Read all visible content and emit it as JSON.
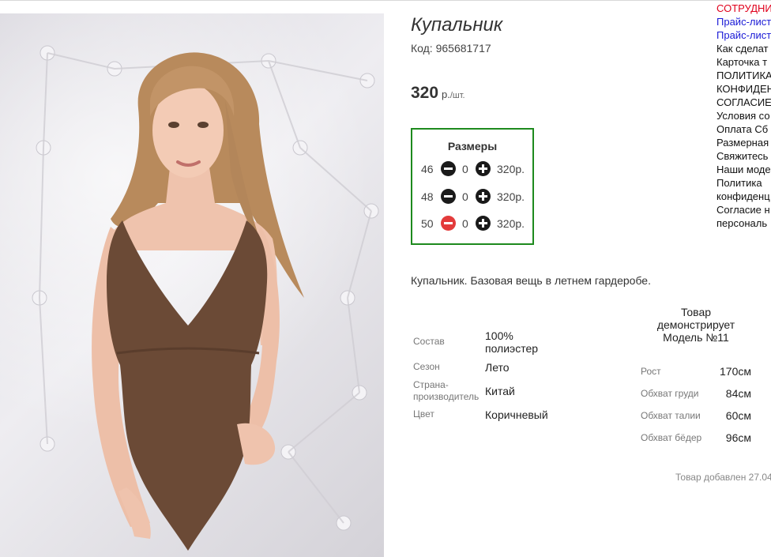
{
  "product": {
    "title": "Купальник",
    "code": "Код: 965681717",
    "price": "320",
    "price_currency": "р.",
    "price_per": "/шт.",
    "description": "Купальник. Базовая вещь в летнем гардеробе."
  },
  "sizes": {
    "title": "Размеры",
    "rows": [
      {
        "size": "46",
        "qty": "0",
        "price": "320р."
      },
      {
        "size": "48",
        "qty": "0",
        "price": "320р."
      },
      {
        "size": "50",
        "qty": "0",
        "price": "320р."
      }
    ]
  },
  "attributes": [
    {
      "label": "Состав",
      "value_line1": "100%",
      "value_line2": "полиэстер"
    },
    {
      "label": "Сезон",
      "value_line1": "Лето"
    },
    {
      "label_line1": "Страна-",
      "label_line2": "производитель",
      "value_line1": "Китай"
    },
    {
      "label": "Цвет",
      "value_line1": "Коричневый"
    }
  ],
  "model": {
    "title_line1": "Товар",
    "title_line2": "демонстрирует",
    "title_line3": "Модель №11",
    "measurements": [
      {
        "label": "Рост",
        "value": "170см"
      },
      {
        "label": "Обхват груди",
        "value": "84см"
      },
      {
        "label": "Обхват талии",
        "value": "60см"
      },
      {
        "label": "Обхват бёдер",
        "value": "96см"
      }
    ]
  },
  "added": "Товар добавлен 27.04",
  "sidebar": [
    "СОТРУДНИ",
    "Прайс-лист",
    "Прайс-лист",
    "Как сделат",
    "Карточка т",
    "ПОЛИТИКА",
    "КОНФИДЕН",
    "СОГЛАСИЕ",
    "Условия со",
    "Оплата Сб",
    "Размерная",
    "Свяжитесь",
    "Наши моде",
    "Политика",
    "конфиденц",
    "Согласие н",
    "персональ"
  ],
  "colors": {
    "accent_green": "#1e8a1e",
    "minus_active_red": "#e33b3b",
    "sidebar_red": "#e0001b",
    "sidebar_blue": "#1a1ad6",
    "swimsuit_brown": "#6b4a36"
  }
}
